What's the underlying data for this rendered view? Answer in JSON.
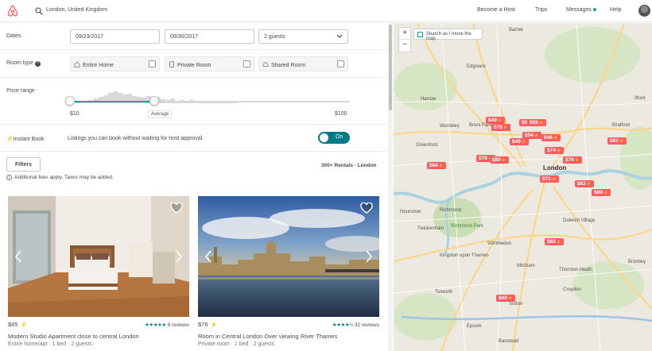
{
  "header": {
    "search_value": "London, United Kingdom",
    "nav": [
      "Become a Host",
      "Trips",
      "Messages",
      "Help"
    ]
  },
  "filters": {
    "dates_label": "Dates",
    "checkin": "09/23/2017",
    "checkout": "09/30/2017",
    "guests": "2 guests",
    "room_type_label": "Room type",
    "room_types": [
      "Entire Home",
      "Private Room",
      "Shared Room"
    ],
    "price_label": "Price range",
    "price_min": "$10",
    "price_max": "$100",
    "price_avg_label": "Average",
    "instant_label": "Instant Book",
    "instant_desc": "Listings you can book without waiting for host approval.",
    "instant_toggle": "On",
    "filters_button": "Filters",
    "results_count": "300+ Rentals · London",
    "fees_note": "Additional fees apply. Taxes may be added."
  },
  "listings": [
    {
      "price": "$85",
      "stars": "★★★★★",
      "reviews": "9 reviews",
      "title": "Modern Studio Apartment close to central London",
      "subtitle": "Entire home/apt · 1 bed · 2 guests"
    },
    {
      "price": "$76",
      "stars": "★★★★½",
      "reviews": "32 reviews",
      "title": "Room in Central London Over viewing River Thames",
      "subtitle": "Private room · 1 bed · 2 guests"
    }
  ],
  "map": {
    "zoom_in": "+",
    "zoom_out": "−",
    "search_toggle": "Search as I move the map",
    "pins": [
      "$56",
      "$49",
      "$75",
      "$56",
      "$54",
      "$46",
      "$49",
      "$62",
      "$74",
      "$78",
      "$80",
      "$76",
      "$84",
      "$71",
      "$83",
      "$89",
      "$82",
      "$60"
    ],
    "places": [
      "Barnet",
      "Edgware",
      "Harrow",
      "Wembley",
      "Brent Park",
      "Greenford",
      "London",
      "Hounslow",
      "Richmond",
      "Twickenham",
      "Kingston upon Thames",
      "Wimbledon",
      "Mitcham",
      "Croydon",
      "Sutton",
      "Epsom",
      "Stratford",
      "Bromley",
      "Thornton Heath",
      "Dulwich Village",
      "Richmond Park",
      "Tolworth",
      "Banstead",
      "Ilford"
    ]
  }
}
